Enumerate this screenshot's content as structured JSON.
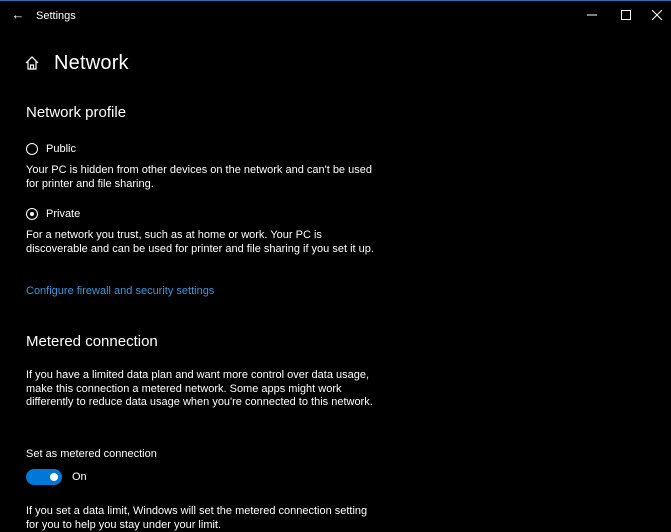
{
  "window": {
    "title": "Settings"
  },
  "page": {
    "title": "Network"
  },
  "network_profile": {
    "heading": "Network profile",
    "options": [
      {
        "label": "Public",
        "selected": false,
        "description": "Your PC is hidden from other devices on the network and can't be used for printer and file sharing."
      },
      {
        "label": "Private",
        "selected": true,
        "description": "For a network you trust, such as at home or work. Your PC is discoverable and can be used for printer and file sharing if you set it up."
      }
    ],
    "link": "Configure firewall and security settings"
  },
  "metered": {
    "heading": "Metered connection",
    "description": "If you have a limited data plan and want more control over data usage, make this connection a metered network. Some apps might work differently to reduce data usage when you're connected to this network.",
    "toggle_label": "Set as metered connection",
    "toggle_state": "On",
    "toggle_on": true,
    "footer": "If you set a data limit, Windows will set the metered connection setting for you to help you stay under your limit."
  },
  "colors": {
    "background": "#000000",
    "accent": "#0078d7",
    "link": "#3a96dd"
  }
}
